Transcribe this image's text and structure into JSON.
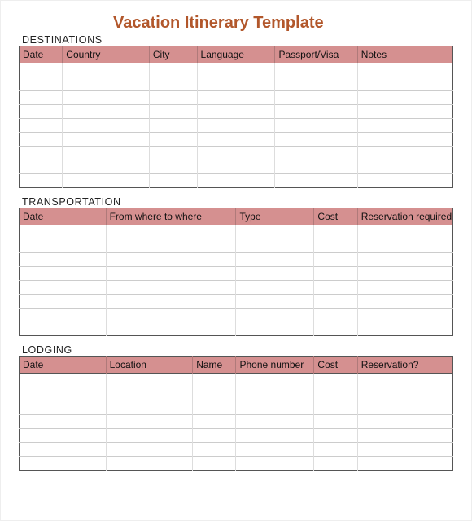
{
  "title": "Vacation Itinerary Template",
  "sections": {
    "destinations": {
      "label": "DESTINATIONS",
      "headers": [
        "Date",
        "Country",
        "City",
        "Language",
        "Passport/Visa",
        "Notes"
      ],
      "widths": [
        10,
        20,
        11,
        18,
        19,
        22
      ],
      "rows": 9
    },
    "transportation": {
      "label": "TRANSPORTATION",
      "headers": [
        "Date",
        "From where to where",
        "Type",
        "Cost",
        "Reservation required?"
      ],
      "widths": [
        20,
        30,
        18,
        10,
        22
      ],
      "rows": 8
    },
    "lodging": {
      "label": "LODGING",
      "headers": [
        "Date",
        "Location",
        "Name",
        "Phone number",
        "Cost",
        "Reservation?"
      ],
      "widths": [
        20,
        20,
        10,
        18,
        10,
        22
      ],
      "rows": 7
    }
  }
}
